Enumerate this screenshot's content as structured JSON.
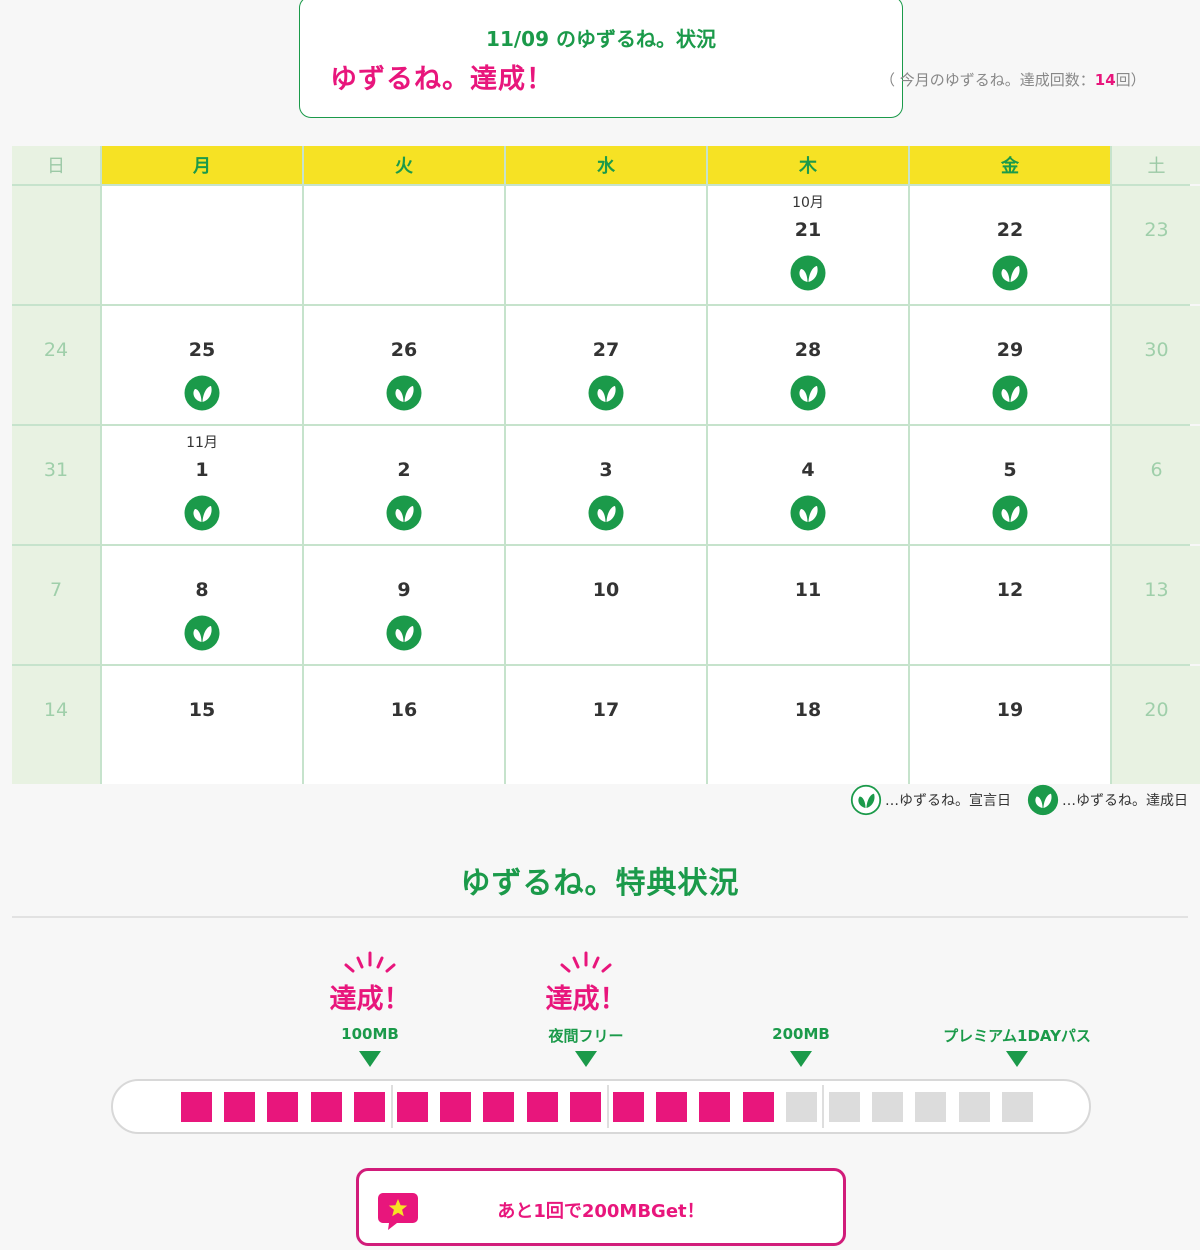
{
  "status": {
    "date_heading": "11/09 のゆずるね。状況",
    "achieved_text": "ゆずるね。達成！",
    "count_prefix": "（ 今月のゆずるね。達成回数：",
    "count_value": "14",
    "count_suffix": "回）"
  },
  "calendar": {
    "weekdays": [
      {
        "label": "日",
        "weekend": true
      },
      {
        "label": "月",
        "weekend": false
      },
      {
        "label": "火",
        "weekend": false
      },
      {
        "label": "水",
        "weekend": false
      },
      {
        "label": "木",
        "weekend": false
      },
      {
        "label": "金",
        "weekend": false
      },
      {
        "label": "土",
        "weekend": true
      }
    ],
    "weeks": [
      [
        {
          "day": "",
          "month": "",
          "weekend": true,
          "mark": "none"
        },
        {
          "day": "",
          "month": "",
          "weekend": false,
          "mark": "none"
        },
        {
          "day": "",
          "month": "",
          "weekend": false,
          "mark": "none"
        },
        {
          "day": "",
          "month": "",
          "weekend": false,
          "mark": "none"
        },
        {
          "day": "21",
          "month": "10月",
          "weekend": false,
          "mark": "achieved"
        },
        {
          "day": "22",
          "month": "",
          "weekend": false,
          "mark": "achieved"
        },
        {
          "day": "23",
          "month": "",
          "weekend": true,
          "mark": "none"
        }
      ],
      [
        {
          "day": "24",
          "month": "",
          "weekend": true,
          "mark": "none"
        },
        {
          "day": "25",
          "month": "",
          "weekend": false,
          "mark": "achieved"
        },
        {
          "day": "26",
          "month": "",
          "weekend": false,
          "mark": "achieved"
        },
        {
          "day": "27",
          "month": "",
          "weekend": false,
          "mark": "achieved"
        },
        {
          "day": "28",
          "month": "",
          "weekend": false,
          "mark": "achieved"
        },
        {
          "day": "29",
          "month": "",
          "weekend": false,
          "mark": "achieved"
        },
        {
          "day": "30",
          "month": "",
          "weekend": true,
          "mark": "none"
        }
      ],
      [
        {
          "day": "31",
          "month": "",
          "weekend": true,
          "mark": "none"
        },
        {
          "day": "1",
          "month": "11月",
          "weekend": false,
          "mark": "achieved"
        },
        {
          "day": "2",
          "month": "",
          "weekend": false,
          "mark": "achieved"
        },
        {
          "day": "3",
          "month": "",
          "weekend": false,
          "mark": "achieved"
        },
        {
          "day": "4",
          "month": "",
          "weekend": false,
          "mark": "achieved"
        },
        {
          "day": "5",
          "month": "",
          "weekend": false,
          "mark": "achieved"
        },
        {
          "day": "6",
          "month": "",
          "weekend": true,
          "mark": "none"
        }
      ],
      [
        {
          "day": "7",
          "month": "",
          "weekend": true,
          "mark": "none"
        },
        {
          "day": "8",
          "month": "",
          "weekend": false,
          "mark": "achieved"
        },
        {
          "day": "9",
          "month": "",
          "weekend": false,
          "mark": "achieved"
        },
        {
          "day": "10",
          "month": "",
          "weekend": false,
          "mark": "none"
        },
        {
          "day": "11",
          "month": "",
          "weekend": false,
          "mark": "none"
        },
        {
          "day": "12",
          "month": "",
          "weekend": false,
          "mark": "none"
        },
        {
          "day": "13",
          "month": "",
          "weekend": true,
          "mark": "none"
        }
      ],
      [
        {
          "day": "14",
          "month": "",
          "weekend": true,
          "mark": "none"
        },
        {
          "day": "15",
          "month": "",
          "weekend": false,
          "mark": "none"
        },
        {
          "day": "16",
          "month": "",
          "weekend": false,
          "mark": "none"
        },
        {
          "day": "17",
          "month": "",
          "weekend": false,
          "mark": "none"
        },
        {
          "day": "18",
          "month": "",
          "weekend": false,
          "mark": "none"
        },
        {
          "day": "19",
          "month": "",
          "weekend": false,
          "mark": "none"
        },
        {
          "day": "20",
          "month": "",
          "weekend": true,
          "mark": "none"
        }
      ]
    ]
  },
  "legend": {
    "declared_label": "…ゆずるね。宣言日",
    "achieved_label": "…ゆずるね。達成日",
    "declared_icon": "leaf-outline-icon",
    "achieved_icon": "leaf-filled-icon"
  },
  "bonus": {
    "title": "ゆずるね。特典状況",
    "milestones": [
      {
        "label": "100MB",
        "achieved": true,
        "achieved_text": "達成！"
      },
      {
        "label": "夜間フリー",
        "achieved": true,
        "achieved_text": "達成！"
      },
      {
        "label": "200MB",
        "achieved": false,
        "achieved_text": ""
      },
      {
        "label": "プレミアム1DAYパス",
        "achieved": false,
        "achieved_text": ""
      }
    ],
    "progress": {
      "filled": 14,
      "total": 20
    },
    "cta_text": "あと1回で200MBGet！",
    "cta_icon": "star-speech-bubble-icon"
  },
  "colors": {
    "green": "#1b9a4a",
    "pink": "#e8167c",
    "yellow": "#f6e224",
    "weekend_bg": "#e8f2e2"
  }
}
